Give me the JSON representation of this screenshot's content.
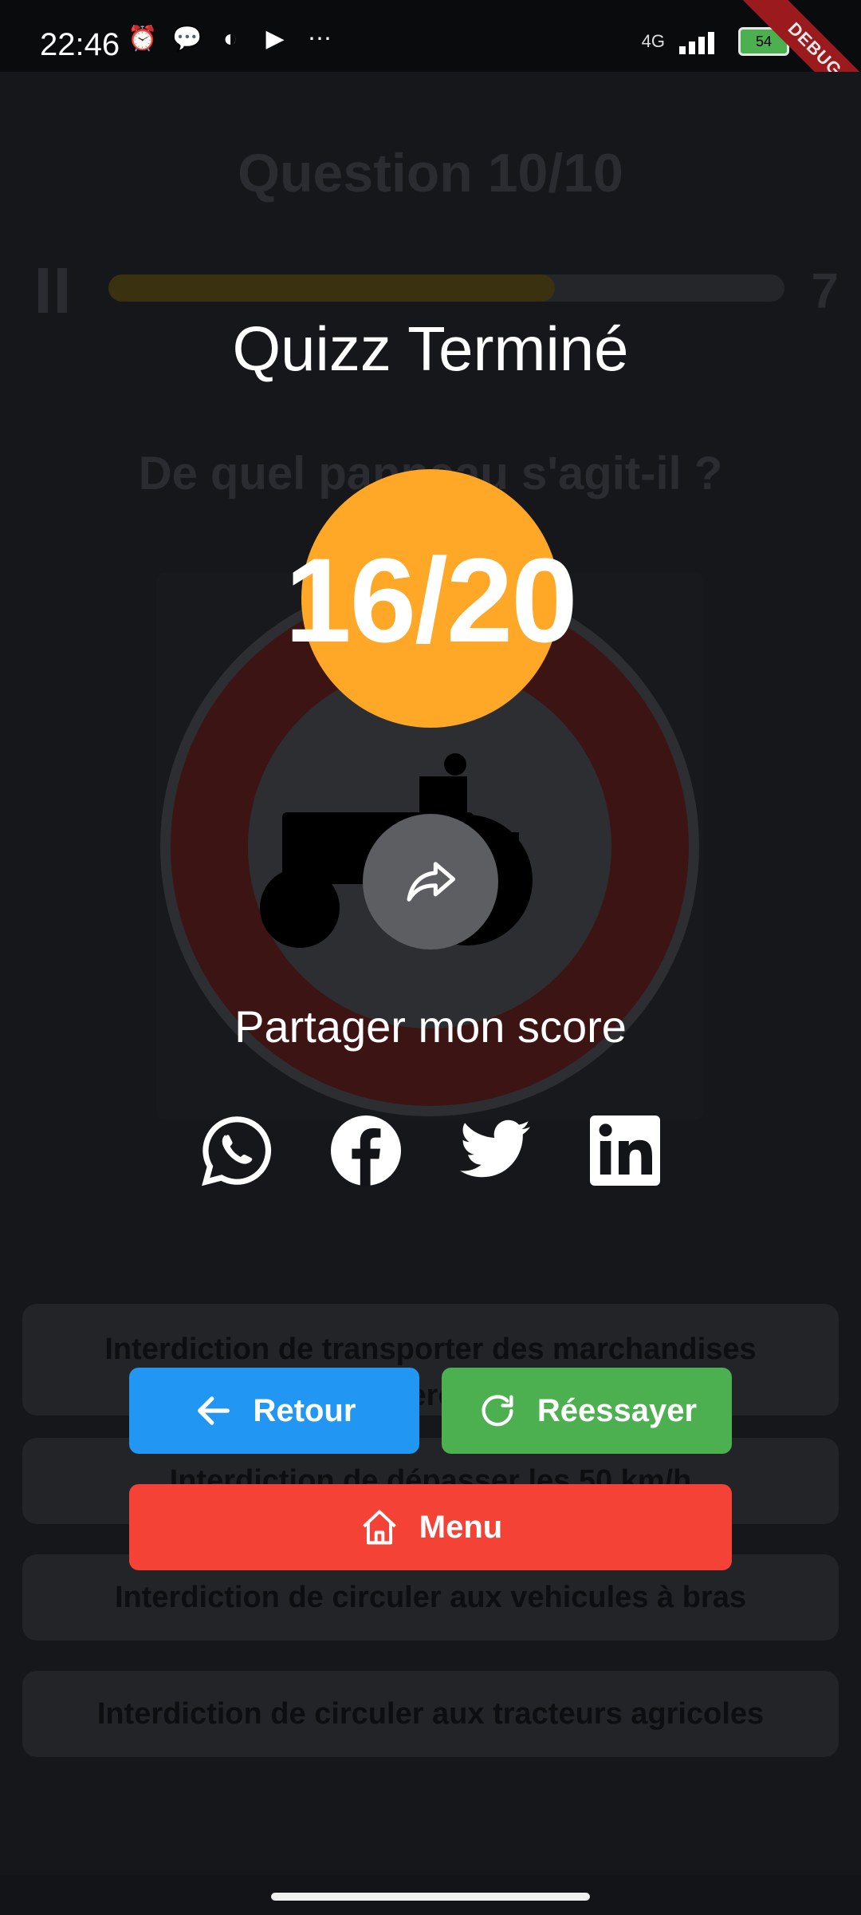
{
  "status_bar": {
    "time": "22:46",
    "network": "4G",
    "battery": "54"
  },
  "debug_banner": "DEBUG",
  "background": {
    "question_header": "Question 10/10",
    "timer": "7",
    "progress": 0.66,
    "prompt": "De quel panneau s'agit-il ?",
    "answers": [
      "Interdiction de transporter des marchandises dangereuses",
      "Interdiction de dépasser les 50 km/h",
      "Interdiction de circuler aux vehicules à bras",
      "Interdiction de circuler aux tracteurs agricoles"
    ]
  },
  "result": {
    "title": "Quizz Terminé",
    "score": "16/20",
    "share_label": "Partager mon score"
  },
  "social_icons": [
    "whatsapp-icon",
    "facebook-icon",
    "twitter-icon",
    "linkedin-icon"
  ],
  "buttons": {
    "back": "Retour",
    "retry": "Réessayer",
    "menu": "Menu"
  },
  "colors": {
    "score": "#ffa726",
    "back": "#2196f3",
    "retry": "#4caf50",
    "menu": "#f44336"
  }
}
